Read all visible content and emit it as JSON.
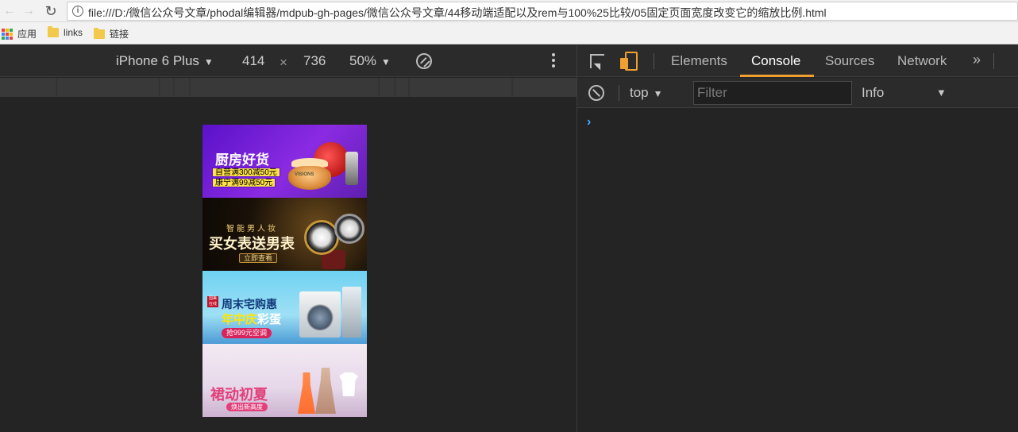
{
  "browser": {
    "url": "file:///D:/微信公众号文章/phodal编辑器/mdpub-gh-pages/微信公众号文章/44移动端适配以及rem与100%25比较/05固定页面宽度改变它的缩放比例.html",
    "bookmarks": [
      {
        "label": "应用",
        "icon": "apps-icon"
      },
      {
        "label": "links",
        "icon": "folder-icon"
      },
      {
        "label": "链接",
        "icon": "folder-icon"
      }
    ]
  },
  "device_toolbar": {
    "device": "iPhone 6 Plus",
    "width": "414",
    "times": "×",
    "height": "736",
    "zoom": "50%"
  },
  "banners": [
    {
      "title": "厨房好货",
      "tag1": "自营满300减50元",
      "tag2": "康宁满99减50元",
      "product_label": "VISIONS"
    },
    {
      "subtitle": "智能男人妆",
      "title": "买女表送男表",
      "button": "立即查看"
    },
    {
      "stamp": "国美在线",
      "title1": "周末宅购惠",
      "title2a": "年中庆",
      "title2b": "彩蛋",
      "pill": "抢999元空调"
    },
    {
      "title": "裙动初夏",
      "button": "焕出新高度"
    }
  ],
  "devtools": {
    "tabs": [
      {
        "label": "Elements",
        "active": false
      },
      {
        "label": "Console",
        "active": true
      },
      {
        "label": "Sources",
        "active": false
      },
      {
        "label": "Network",
        "active": false
      }
    ],
    "more": "»",
    "context": "top",
    "filter_placeholder": "Filter",
    "level": "Info",
    "prompt": "›"
  },
  "colors": {
    "accent": "#f0a030",
    "prompt": "#4da6ff"
  }
}
